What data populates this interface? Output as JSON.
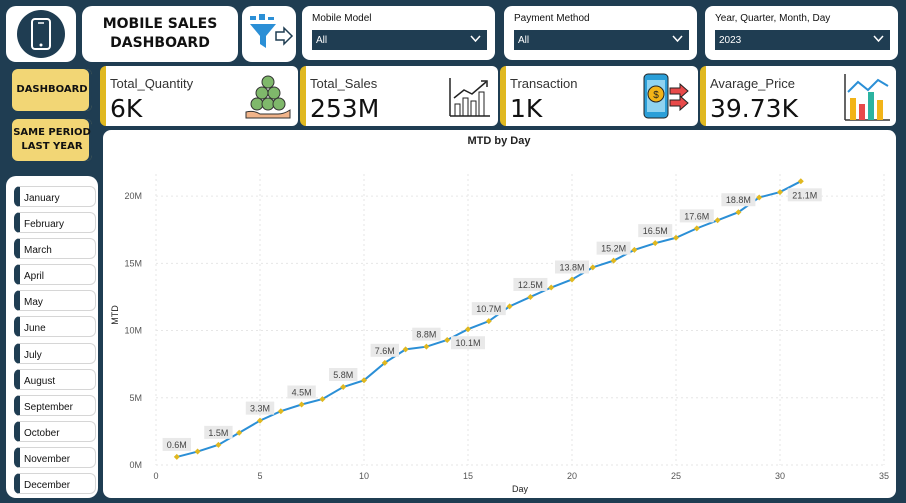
{
  "header": {
    "title": "MOBILE  SALES\nDASHBOARD",
    "logo_icon": "smartphone-icon",
    "filter_icon": "funnel-filter-icon"
  },
  "filters": [
    {
      "label": "Mobile Model",
      "value": "All"
    },
    {
      "label": "Payment Method",
      "value": "All"
    },
    {
      "label": "Year, Quarter, Month, Day",
      "value": "2023"
    }
  ],
  "nav": {
    "dashboard": "DASHBOARD",
    "same_period": "SAME PERIOD\nLAST YEAR"
  },
  "months": [
    "January",
    "February",
    "March",
    "April",
    "May",
    "June",
    "July",
    "August",
    "September",
    "October",
    "November",
    "December"
  ],
  "kpis": [
    {
      "label": "Total_Quantity",
      "value": "6K",
      "icon": "coins-hand-icon"
    },
    {
      "label": "Total_Sales",
      "value": "253M",
      "icon": "bar-growth-chart-icon"
    },
    {
      "label": "Transaction",
      "value": "1K",
      "icon": "phone-payment-icon"
    },
    {
      "label": "Avarage_Price",
      "value": "39.73K",
      "icon": "bar-trend-chart-icon"
    }
  ],
  "colors": {
    "background": "#1f3d52",
    "accent": "#e0b820",
    "nav_button": "#f2d675",
    "line": "#2b8fd6",
    "marker": "#e0b820"
  },
  "chart_data": {
    "type": "line",
    "title": "MTD by Day",
    "xlabel": "Day",
    "ylabel": "MTD",
    "xlim": [
      0,
      35
    ],
    "ylim": [
      0,
      21000000
    ],
    "x_ticks": [
      "0",
      "5",
      "10",
      "15",
      "20",
      "25",
      "30",
      "35"
    ],
    "y_ticks": [
      "0M",
      "5M",
      "10M",
      "15M",
      "20M"
    ],
    "grid": true,
    "x": [
      1,
      2,
      3,
      4,
      5,
      6,
      7,
      8,
      9,
      10,
      11,
      12,
      13,
      14,
      15,
      16,
      17,
      18,
      19,
      20,
      21,
      22,
      23,
      24,
      25,
      26,
      27,
      28,
      29,
      30,
      31
    ],
    "values": [
      0.6,
      1.0,
      1.5,
      2.4,
      3.3,
      4.0,
      4.5,
      4.9,
      5.8,
      6.3,
      7.6,
      8.6,
      8.8,
      9.3,
      10.1,
      10.7,
      11.8,
      12.5,
      13.2,
      13.8,
      14.7,
      15.2,
      16.0,
      16.5,
      16.9,
      17.6,
      18.2,
      18.8,
      19.9,
      20.3,
      21.1
    ],
    "value_unit": "M",
    "data_labels": [
      {
        "day": 1,
        "text": "0.6M"
      },
      {
        "day": 3,
        "text": "1.5M"
      },
      {
        "day": 5,
        "text": "3.3M"
      },
      {
        "day": 7,
        "text": "4.5M"
      },
      {
        "day": 9,
        "text": "5.8M"
      },
      {
        "day": 11,
        "text": "7.6M"
      },
      {
        "day": 13,
        "text": "8.8M"
      },
      {
        "day": 15,
        "text": "10.1M"
      },
      {
        "day": 16,
        "text": "10.7M"
      },
      {
        "day": 18,
        "text": "12.5M"
      },
      {
        "day": 20,
        "text": "13.8M"
      },
      {
        "day": 22,
        "text": "15.2M"
      },
      {
        "day": 24,
        "text": "16.5M"
      },
      {
        "day": 26,
        "text": "17.6M"
      },
      {
        "day": 28,
        "text": "18.8M"
      },
      {
        "day": 31,
        "text": "21.1M"
      }
    ]
  }
}
